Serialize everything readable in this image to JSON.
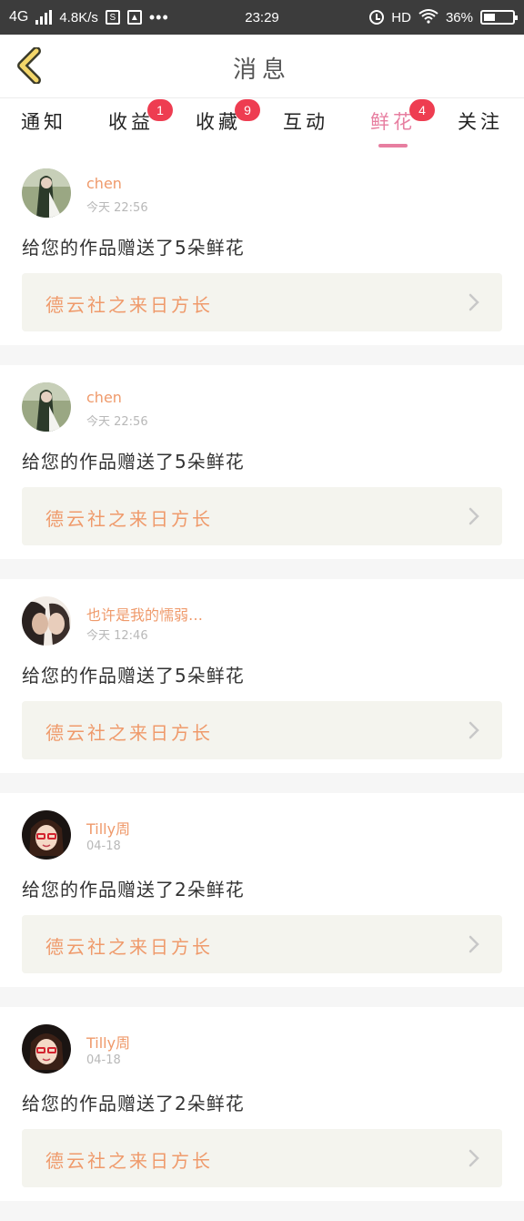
{
  "status_bar": {
    "network": "4G",
    "speed": "4.8K/s",
    "box_icon_label": "S",
    "time": "23:29",
    "hd": "HD",
    "battery": "36%"
  },
  "header": {
    "title": "消息"
  },
  "tabs": [
    {
      "label": "通知",
      "badge": null,
      "active": false
    },
    {
      "label": "收益",
      "badge": "1",
      "active": false
    },
    {
      "label": "收藏",
      "badge": "9",
      "active": false
    },
    {
      "label": "互动",
      "badge": null,
      "active": false
    },
    {
      "label": "鲜花",
      "badge": "4",
      "active": true
    },
    {
      "label": "关注",
      "badge": null,
      "active": false
    }
  ],
  "feed": [
    {
      "user": "chen",
      "time": "今天 22:56",
      "message": "给您的作品赠送了5朵鲜花",
      "work": "德云社之来日方长",
      "avatar": "avatar-girl-forest"
    },
    {
      "user": "chen",
      "time": "今天 22:56",
      "message": "给您的作品赠送了5朵鲜花",
      "work": "德云社之来日方长",
      "avatar": "avatar-girl-forest"
    },
    {
      "user": "也许是我的懦弱…",
      "time": "今天 12:46",
      "message": "给您的作品赠送了5朵鲜花",
      "work": "德云社之来日方长",
      "avatar": "avatar-couple"
    },
    {
      "user": "Tilly周",
      "time": "04-18",
      "message": "给您的作品赠送了2朵鲜花",
      "work": "德云社之来日方长",
      "avatar": "avatar-cartoon-girl"
    },
    {
      "user": "Tilly周",
      "time": "04-18",
      "message": "给您的作品赠送了2朵鲜花",
      "work": "德云社之来日方长",
      "avatar": "avatar-cartoon-girl"
    }
  ],
  "colors": {
    "accent_pink": "#e77ea0",
    "badge_red": "#ee3d51",
    "username_orange": "#ef9a6b",
    "back_yellow": "#f3d66a"
  }
}
